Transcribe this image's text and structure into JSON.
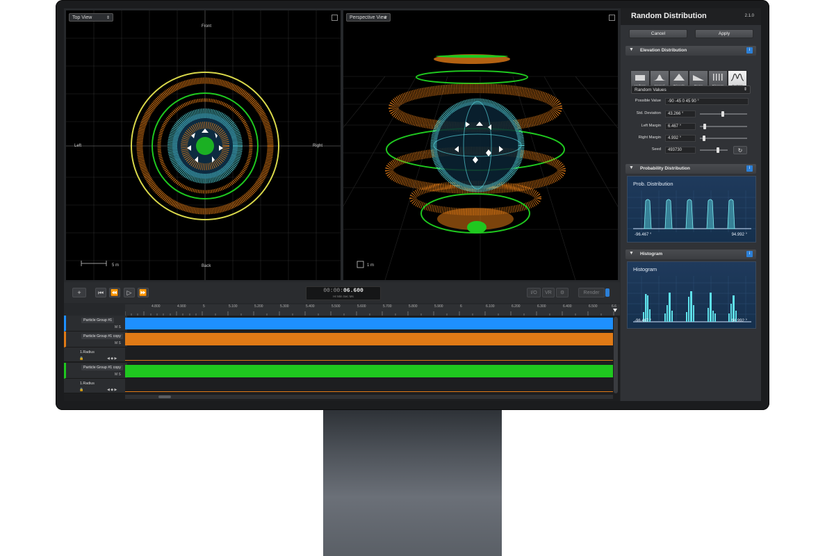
{
  "viewports": {
    "top": {
      "selector": "Top View",
      "front": "Front",
      "back": "Back",
      "left": "Left",
      "right": "Right",
      "scale": "5 m"
    },
    "perspective": {
      "selector": "Perspective View",
      "scale": "1 m"
    }
  },
  "transport": {
    "add": "+",
    "time_dim": "00:00:",
    "time_bright": "06.600",
    "time_units": "Hr  Min  Sec  Ms",
    "io": "I/O",
    "vr": "VR",
    "render": "Render"
  },
  "ruler": {
    "ticks": [
      "4.800",
      "4.900",
      "5",
      "5.100",
      "5.200",
      "5.300",
      "5.400",
      "5.500",
      "5.600",
      "5.700",
      "5.800",
      "5.900",
      "6",
      "6.100",
      "6.200",
      "6.300",
      "6.400",
      "6.500",
      "6.6"
    ]
  },
  "tracks": [
    {
      "name": "Particle Group #1",
      "ms": "M S",
      "color": "#1e90ff"
    },
    {
      "name": "Particle Group #1 copy",
      "ms": "M S",
      "color": "#e07a16",
      "sub": "1.Radius"
    },
    {
      "name": "Particle Group #1 copy",
      "ms": "M S",
      "color": "#1fc81f",
      "sub": "1.Radius"
    }
  ],
  "panel": {
    "title": "Random Distribution",
    "version": "2.1.0",
    "cancel": "Cancel",
    "apply": "Apply",
    "elevation": {
      "title": "Elevation Distribution",
      "buttons": [
        "Uniform",
        "Normal",
        "Triangle",
        "Ramp",
        "Discrete",
        "Custom"
      ],
      "selected": "Custom",
      "mode": "Random Values",
      "possible_value_label": "Possible Value",
      "possible_value": "-90 -45 0 45 90 °",
      "std_label": "Std. Deviation",
      "std_value": "43.266 °",
      "left_label": "Left Margin",
      "left_value": "6.467 °",
      "right_label": "Right Margin",
      "right_value": "4.992 °",
      "seed_label": "Seed",
      "seed_value": "493730"
    },
    "probability": {
      "title": "Probability Distribution",
      "chart_title": "Prob. Distribution",
      "min": "-96.467 °",
      "max": "94.992 °"
    },
    "histogram": {
      "title": "Histogram",
      "chart_title": "Histogram",
      "min": "-96.467 °",
      "max": "94.992 °"
    }
  },
  "colors": {
    "blue": "#1e90ff",
    "orange": "#e07a16",
    "green": "#1fc81f",
    "cyan": "#5de8f0",
    "yellow": "#d9d84a"
  }
}
